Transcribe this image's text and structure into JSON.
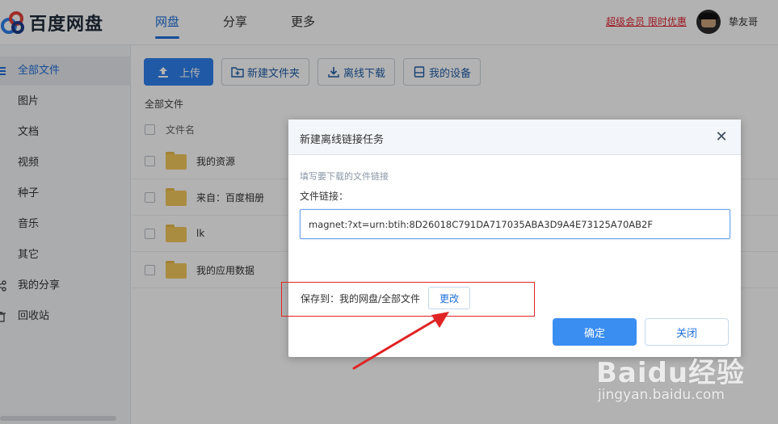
{
  "header": {
    "logo_text": "百度网盘",
    "tabs": [
      {
        "label": "网盘",
        "active": true
      },
      {
        "label": "分享",
        "active": false
      },
      {
        "label": "更多",
        "active": false
      }
    ],
    "promo": "超级会员 限时优惠",
    "username": "挚友哥"
  },
  "sidebar": {
    "items": [
      {
        "label": "全部文件",
        "icon": "list-icon",
        "active": true
      },
      {
        "label": "图片",
        "icon": "",
        "active": false
      },
      {
        "label": "文档",
        "icon": "",
        "active": false
      },
      {
        "label": "视频",
        "icon": "",
        "active": false
      },
      {
        "label": "种子",
        "icon": "",
        "active": false
      },
      {
        "label": "音乐",
        "icon": "",
        "active": false
      },
      {
        "label": "其它",
        "icon": "",
        "active": false
      },
      {
        "label": "我的分享",
        "icon": "share-icon",
        "active": false
      },
      {
        "label": "回收站",
        "icon": "trash-icon",
        "active": false
      }
    ]
  },
  "toolbar": {
    "upload": "上传",
    "new_folder": "新建文件夹",
    "offline_download": "离线下载",
    "my_devices": "我的设备"
  },
  "breadcrumb": "全部文件",
  "list": {
    "header_name": "文件名",
    "rows": [
      {
        "name": "我的资源"
      },
      {
        "name": "来自：百度相册"
      },
      {
        "name": "lk"
      },
      {
        "name": "我的应用数据"
      }
    ]
  },
  "dialog": {
    "title": "新建离线链接任务",
    "close_symbol": "✕",
    "hint": "填写要下载的文件链接",
    "link_label": "文件链接：",
    "link_value": "magnet:?xt=urn:btih:8D26018C791DA717035ABA3D9A4E73125A70AB2F",
    "save_to": "保存到：我的网盘/全部文件",
    "change": "更改",
    "confirm": "确定",
    "cancel": "关闭"
  },
  "watermark": {
    "logo": "Baidu经验",
    "url": "jingyan.baidu.com"
  },
  "colors": {
    "accent": "#2f80ed",
    "promo": "#e02433",
    "annotation": "#e02424"
  }
}
